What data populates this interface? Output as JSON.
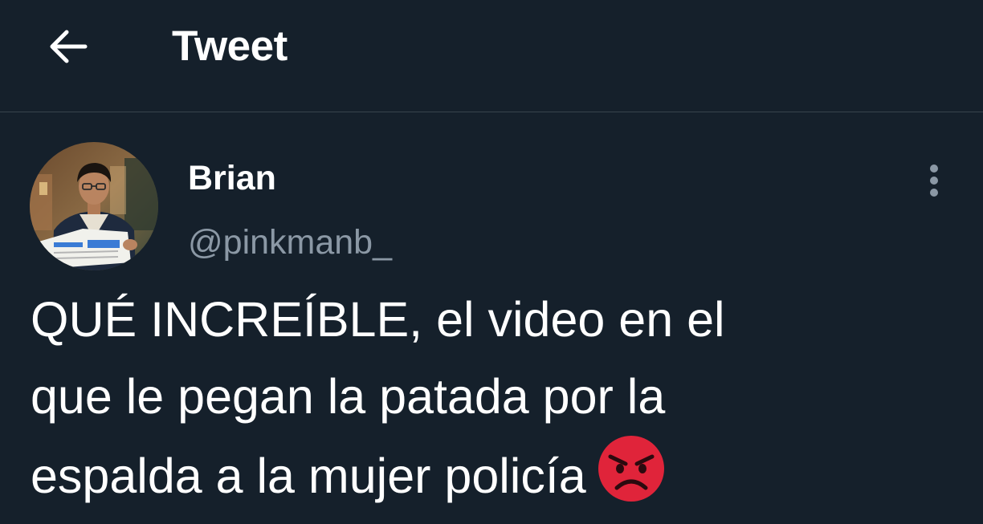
{
  "header": {
    "back_icon": "arrow-left-icon",
    "title": "Tweet"
  },
  "tweet": {
    "author": {
      "display_name": "Brian",
      "handle": "@pinkmanb_",
      "avatar_icon": "user-avatar-photo"
    },
    "more_icon": "more-vertical-icon",
    "text_lines": [
      "QUÉ INCREÍBLE, el video en el",
      "que le pegan la patada por la",
      "espalda a la mujer policía"
    ],
    "emoji": "angry-face-icon"
  },
  "colors": {
    "background": "#15202b",
    "divider": "#38444d",
    "primary_text": "#ffffff",
    "secondary_text": "#8b98a5",
    "emoji_red": "#e0243a"
  }
}
